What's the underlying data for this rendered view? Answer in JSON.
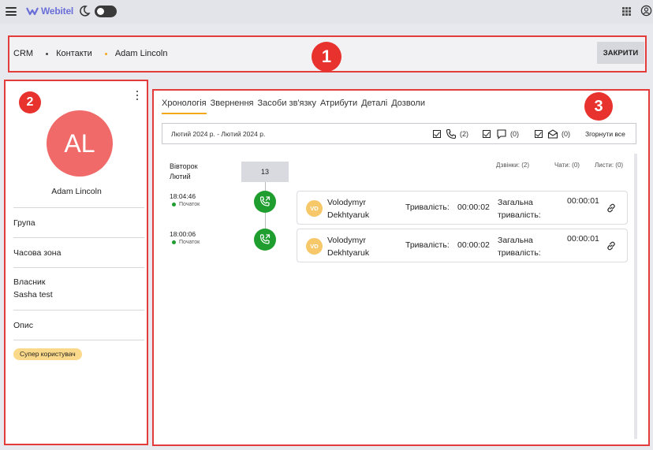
{
  "app": {
    "name": "Webitel"
  },
  "breadcrumb": {
    "items": [
      "CRM",
      "Контакти",
      "Adam Lincoln"
    ],
    "close_label": "ЗАКРИТИ"
  },
  "annotations": [
    "1",
    "2",
    "3"
  ],
  "contact": {
    "initials": "AL",
    "name": "Adam Lincoln",
    "fields": [
      {
        "label": "Група",
        "value": ""
      },
      {
        "label": "Часова зона",
        "value": ""
      },
      {
        "label": "Власник",
        "value": "Sasha test"
      },
      {
        "label": "Опис",
        "value": ""
      }
    ],
    "tag": "Супер користувач"
  },
  "tabs": [
    "Хронологія",
    "Звернення",
    "Засоби зв'язку",
    "Атрибути",
    "Деталі",
    "Дозволи"
  ],
  "filter": {
    "period": "Лютий 2024 р. - Лютий 2024 р.",
    "calls_count": "(2)",
    "chats_count": "(0)",
    "emails_count": "(0)",
    "collapse_all": "Згорнути все"
  },
  "day": {
    "weekday": "Вівторок",
    "month": "Лютий",
    "number": "13",
    "stats": {
      "calls": "Дзвінки: (2)",
      "chats": "Чати: (0)",
      "emails": "Листи: (0)"
    }
  },
  "events": [
    {
      "time": "18:04:46",
      "status": "Початок",
      "agent_initials": "VD",
      "agent_first": "Volodymyr",
      "agent_last": "Dekhtyaruk",
      "duration_label": "Тривалість:",
      "duration": "00:00:02",
      "total_label_1": "Загальна",
      "total_label_2": "тривалість:",
      "total": "00:00:01"
    },
    {
      "time": "18:00:06",
      "status": "Початок",
      "agent_initials": "VD",
      "agent_first": "Volodymyr",
      "agent_last": "Dekhtyaruk",
      "duration_label": "Тривалість:",
      "duration": "00:00:02",
      "total_label_1": "Загальна",
      "total_label_2": "тривалість:",
      "total": "00:00:01"
    }
  ],
  "colors": {
    "accent": "#f3a81c",
    "call_green": "#1f9d2f",
    "avatar": "#f06a6a",
    "annotation_red": "#e8322e"
  },
  "icons": [
    "menu-icon",
    "webitel-logo-icon",
    "moon-icon",
    "apps-grid-icon",
    "account-icon",
    "kebab-icon",
    "phone-icon",
    "chat-icon",
    "email-icon",
    "outgoing-call-icon",
    "link-icon"
  ]
}
